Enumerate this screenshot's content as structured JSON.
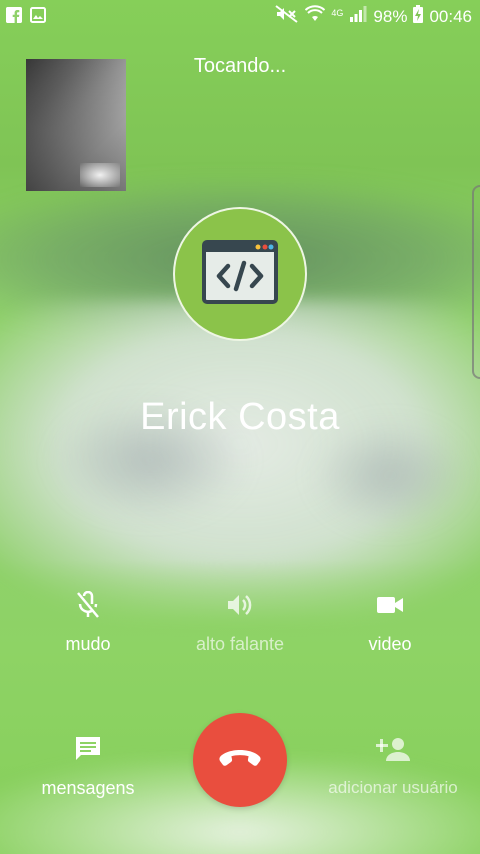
{
  "status_bar": {
    "battery": "98%",
    "time": "00:46",
    "network": "4G",
    "icons": [
      "facebook-icon",
      "gallery-icon",
      "mute-icon",
      "wifi-icon",
      "signal-icon",
      "battery-charging-icon"
    ]
  },
  "call": {
    "status": "Tocando...",
    "contact_name": "Erick Costa",
    "avatar_icon": "code-window-icon"
  },
  "controls": {
    "mute_label": "mudo",
    "speaker_label": "alto falante",
    "video_label": "video",
    "messages_label": "mensagens",
    "add_user_label": "adicionar usuário"
  },
  "colors": {
    "background_green": "#86cf5a",
    "end_call_red": "#e94e3e",
    "avatar_green": "#8bc34a"
  }
}
